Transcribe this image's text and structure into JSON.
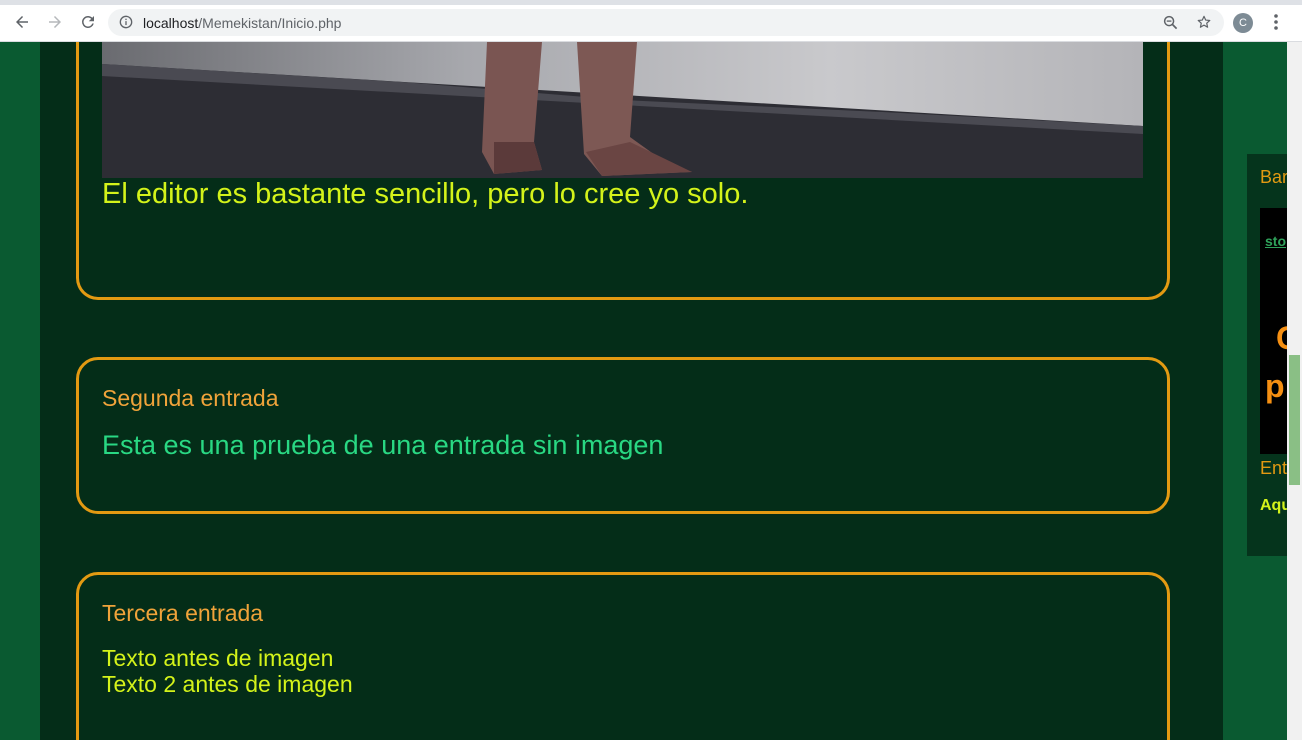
{
  "browser": {
    "url_host": "localhost",
    "url_path": "/Memekistan/Inicio.php",
    "profile_initial": "C"
  },
  "entries": [
    {
      "text": "El editor es bastante sencillo, pero lo cree yo solo."
    },
    {
      "title": "Segunda entrada",
      "text": "Esta es una prueba de una entrada sin imagen"
    },
    {
      "title": "Tercera entrada",
      "lines": [
        "Texto antes de imagen",
        "Texto 2 antes de imagen"
      ]
    }
  ],
  "sidebar": {
    "section1_title": "Bar",
    "banner_link": "sto",
    "banner_big1": "C",
    "banner_big2": "p",
    "section2_title": "Ent",
    "section2_link": "Aqu"
  },
  "colors": {
    "page_bg": "#0a5a31",
    "content_bg": "#042d18",
    "border": "#e39a12",
    "title": "#f0a33a",
    "text_yellow": "#d4f31a",
    "text_green": "#29d883"
  }
}
